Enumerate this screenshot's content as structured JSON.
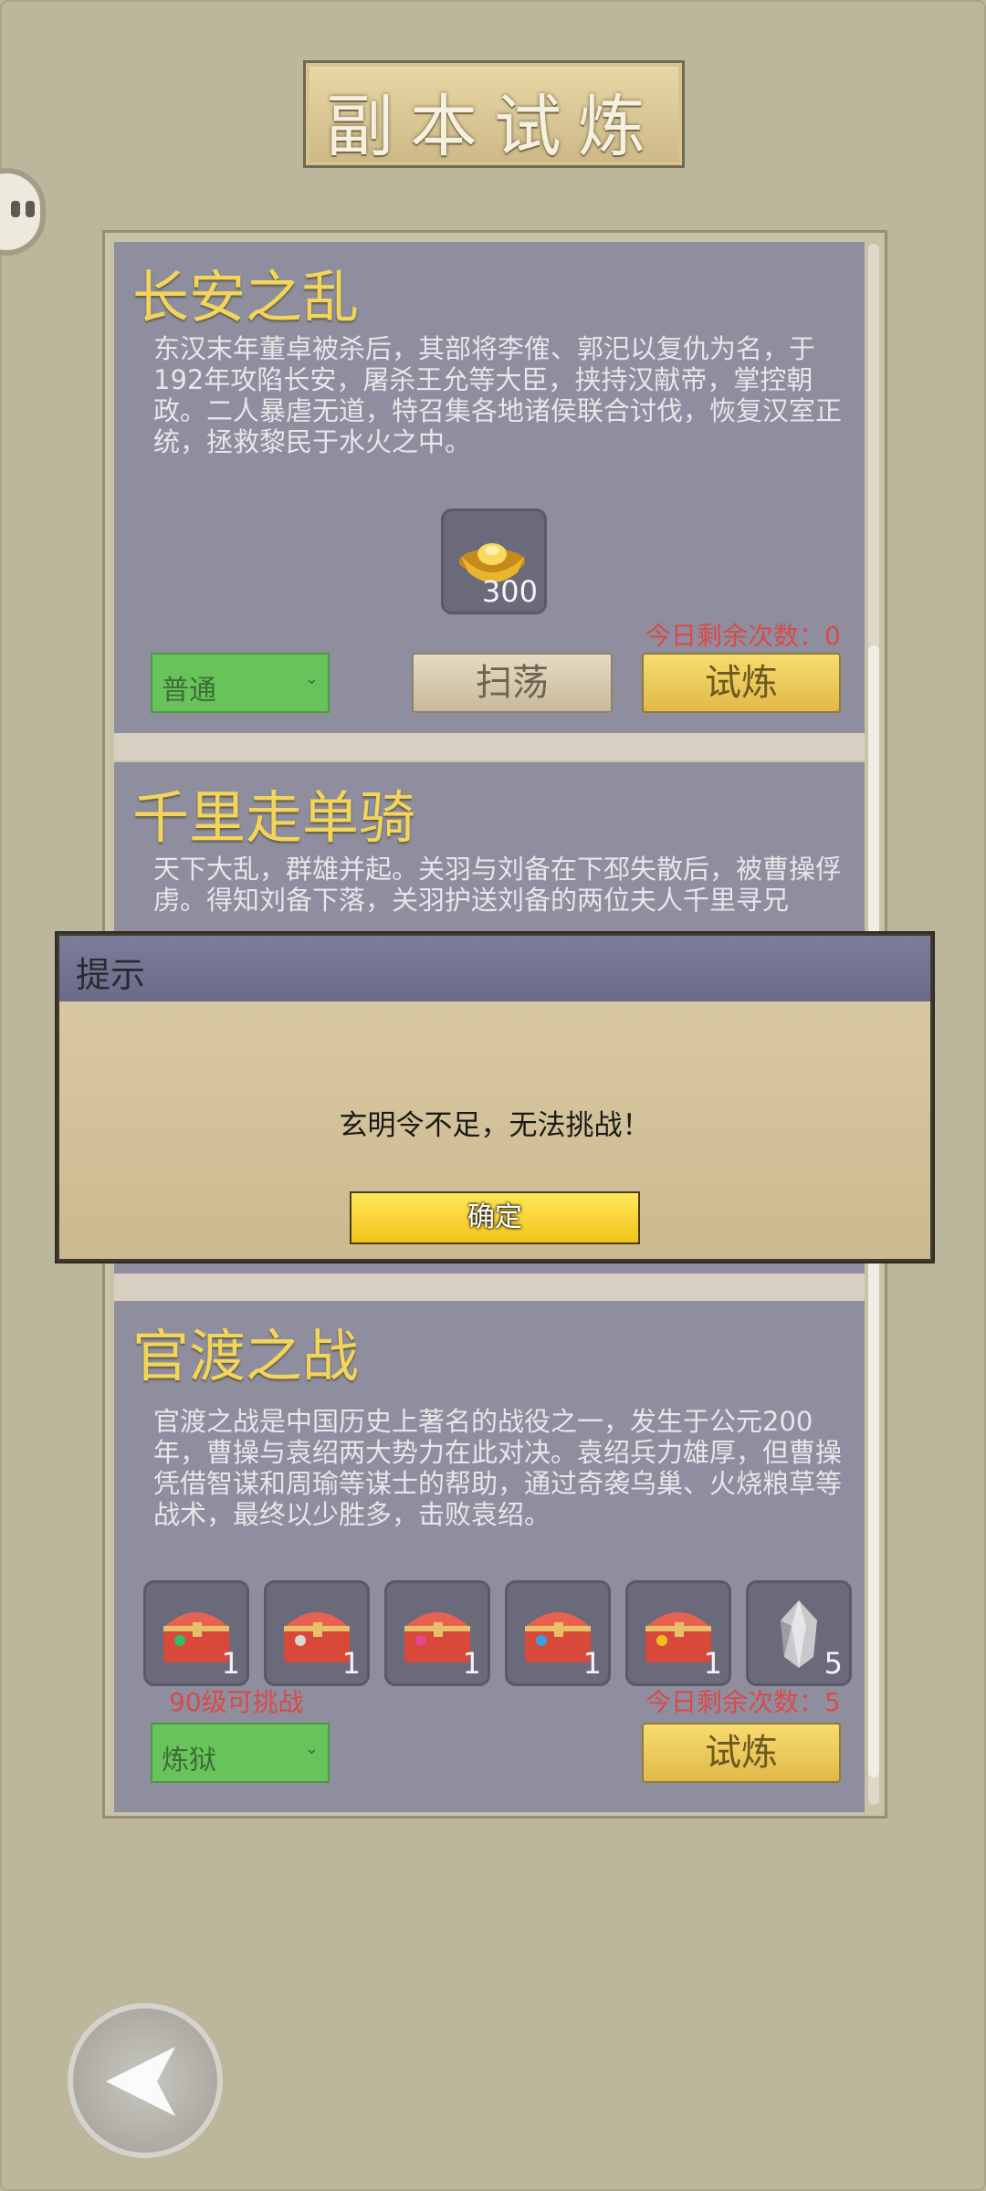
{
  "header": {
    "title": "副本试炼"
  },
  "cards": [
    {
      "title": "长安之乱",
      "description": "东汉末年董卓被杀后，其部将李傕、郭汜以复仇为名，于192年攻陷长安，屠杀王允等大臣，挟持汉献帝，掌控朝政。二人暴虐无道，特召集各地诸侯联合讨伐，恢复汉室正统，拯救黎民于水火之中。",
      "rewards": [
        {
          "icon": "gold-ingot-icon",
          "qty": "300"
        }
      ],
      "remaining": "今日剩余次数：0",
      "difficulty": "普通",
      "sweep_label": "扫荡",
      "trial_label": "试炼"
    },
    {
      "title": "千里走单骑",
      "description": "天下大乱，群雄并起。关羽与刘备在下邳失散后，被曹操俘虏。得知刘备下落，关羽护送刘备的两位夫人千里寻兄"
    },
    {
      "title": "官渡之战",
      "description": "官渡之战是中国历史上著名的战役之一，发生于公元200年，曹操与袁绍两大势力在此对决。袁绍兵力雄厚，但曹操凭借智谋和周瑜等谋士的帮助，通过奇袭乌巢、火烧粮草等战术，最终以少胜多，击败袁绍。",
      "rewards": [
        {
          "icon": "treasure-chest-icon",
          "qty": "1",
          "gem": "#2dbf6a"
        },
        {
          "icon": "treasure-chest-icon",
          "qty": "1",
          "gem": "#d8d8d8"
        },
        {
          "icon": "treasure-chest-icon",
          "qty": "1",
          "gem": "#e04a8a"
        },
        {
          "icon": "treasure-chest-icon",
          "qty": "1",
          "gem": "#3aa0e0"
        },
        {
          "icon": "treasure-chest-icon",
          "qty": "1",
          "gem": "#f0c020"
        },
        {
          "icon": "ore-stone-icon",
          "qty": "5"
        }
      ],
      "level_requirement": "90级可挑战",
      "remaining": "今日剩余次数：5",
      "difficulty": "炼狱",
      "trial_label": "试炼"
    }
  ],
  "dialog": {
    "title": "提示",
    "message": "玄明令不足，无法挑战！",
    "ok_label": "确定"
  },
  "colors": {
    "title_gold": "#f2d55a",
    "warning_red": "#d94a4a",
    "select_green": "#68c35a",
    "trial_button": "#f0c74f"
  }
}
